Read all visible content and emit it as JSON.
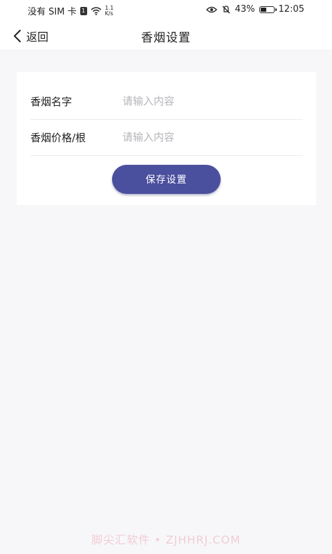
{
  "status_bar": {
    "carrier": "没有 SIM 卡",
    "sim_badge": "1",
    "net_speed_value": "1.1",
    "net_speed_unit": "K/s",
    "battery_level": "43%",
    "battery_fraction": 0.43,
    "time": "12:05",
    "icons": [
      "wifi-icon",
      "eye-icon",
      "mute-icon",
      "battery-icon"
    ]
  },
  "nav": {
    "back_label": "返回",
    "title": "香烟设置"
  },
  "form": {
    "name_label": "香烟名字",
    "name_placeholder": "请输入内容",
    "price_label": "香烟价格/根",
    "price_placeholder": "请输入内容",
    "save_label": "保存设置"
  },
  "watermark": "脚尖汇软件 • ZJHHRJ.COM",
  "colors": {
    "accent": "#4a4f9e",
    "background": "#f7f7f9",
    "card": "#ffffff",
    "placeholder": "#b5b5bb"
  }
}
